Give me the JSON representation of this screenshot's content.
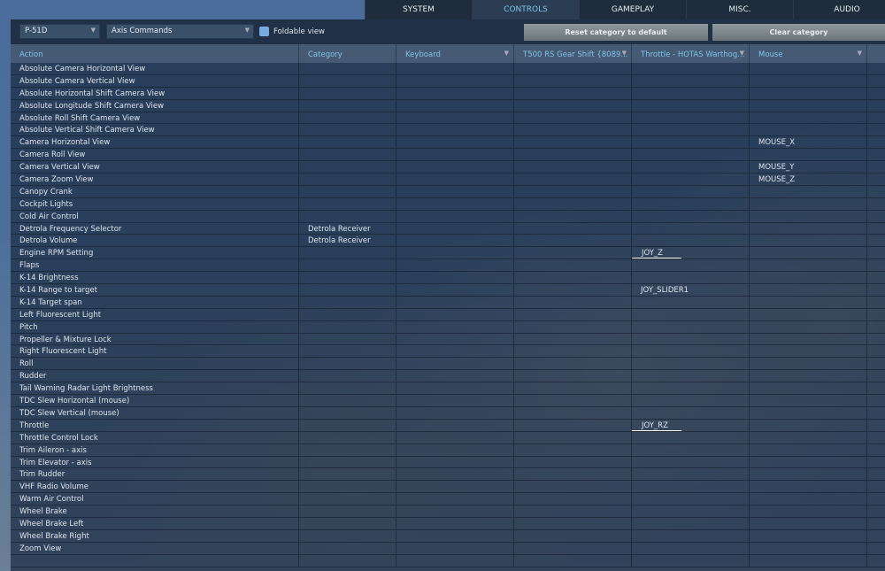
{
  "tabs": [
    "SYSTEM",
    "CONTROLS",
    "GAMEPLAY",
    "MISC.",
    "AUDIO"
  ],
  "active_tab": 1,
  "toolbar": {
    "aircraft": "P-51D",
    "category": "Axis Commands",
    "foldable_label": "Foldable view",
    "reset_label": "Reset category to default",
    "clear_label": "Clear category"
  },
  "columns": [
    "Action",
    "Category",
    "Keyboard",
    "T500 RS Gear Shift {8089...",
    "Throttle - HOTAS Warthog...",
    "Mouse"
  ],
  "rows": [
    [
      "Absolute Camera Horizontal View",
      "",
      "",
      "",
      "",
      ""
    ],
    [
      "Absolute Camera Vertical View",
      "",
      "",
      "",
      "",
      ""
    ],
    [
      "Absolute Horizontal Shift Camera View",
      "",
      "",
      "",
      "",
      ""
    ],
    [
      "Absolute Longitude Shift Camera View",
      "",
      "",
      "",
      "",
      ""
    ],
    [
      "Absolute Roll Shift Camera View",
      "",
      "",
      "",
      "",
      ""
    ],
    [
      "Absolute Vertical Shift Camera View",
      "",
      "",
      "",
      "",
      ""
    ],
    [
      "Camera Horizontal View",
      "",
      "",
      "",
      "",
      "MOUSE_X"
    ],
    [
      "Camera Roll View",
      "",
      "",
      "",
      "",
      ""
    ],
    [
      "Camera Vertical View",
      "",
      "",
      "",
      "",
      "MOUSE_Y"
    ],
    [
      "Camera Zoom View",
      "",
      "",
      "",
      "",
      "MOUSE_Z"
    ],
    [
      "Canopy Crank",
      "",
      "",
      "",
      "",
      ""
    ],
    [
      "Cockpit Lights",
      "",
      "",
      "",
      "",
      ""
    ],
    [
      "Cold Air Control",
      "",
      "",
      "",
      "",
      ""
    ],
    [
      "Detrola Frequency Selector",
      "Detrola Receiver",
      "",
      "",
      "",
      ""
    ],
    [
      "Detrola Volume",
      "Detrola Receiver",
      "",
      "",
      "",
      ""
    ],
    [
      "Engine RPM Setting",
      "",
      "",
      "",
      "JOY_Z",
      ""
    ],
    [
      "Flaps",
      "",
      "",
      "",
      "",
      ""
    ],
    [
      "K-14 Brightness",
      "",
      "",
      "",
      "",
      ""
    ],
    [
      "K-14 Range to target",
      "",
      "",
      "",
      "JOY_SLIDER1",
      ""
    ],
    [
      "K-14 Target span",
      "",
      "",
      "",
      "",
      ""
    ],
    [
      "Left Fluorescent Light",
      "",
      "",
      "",
      "",
      ""
    ],
    [
      "Pitch",
      "",
      "",
      "",
      "",
      ""
    ],
    [
      "Propeller & Mixture Lock",
      "",
      "",
      "",
      "",
      ""
    ],
    [
      "Right Fluorescent Light",
      "",
      "",
      "",
      "",
      ""
    ],
    [
      "Roll",
      "",
      "",
      "",
      "",
      ""
    ],
    [
      "Rudder",
      "",
      "",
      "",
      "",
      ""
    ],
    [
      "Tail Warning Radar Light Brightness",
      "",
      "",
      "",
      "",
      ""
    ],
    [
      "TDC Slew Horizontal (mouse)",
      "",
      "",
      "",
      "",
      ""
    ],
    [
      "TDC Slew Vertical (mouse)",
      "",
      "",
      "",
      "",
      ""
    ],
    [
      "Throttle",
      "",
      "",
      "",
      "JOY_RZ",
      ""
    ],
    [
      "Throttle Control Lock",
      "",
      "",
      "",
      "",
      ""
    ],
    [
      "Trim Aileron - axis",
      "",
      "",
      "",
      "",
      ""
    ],
    [
      "Trim Elevator - axis",
      "",
      "",
      "",
      "",
      ""
    ],
    [
      "Trim Rudder",
      "",
      "",
      "",
      "",
      ""
    ],
    [
      "VHF Radio Volume",
      "",
      "",
      "",
      "",
      ""
    ],
    [
      "Warm Air Control",
      "",
      "",
      "",
      "",
      ""
    ],
    [
      "Wheel Brake",
      "",
      "",
      "",
      "",
      ""
    ],
    [
      "Wheel Brake Left",
      "",
      "",
      "",
      "",
      ""
    ],
    [
      "Wheel Brake Right",
      "",
      "",
      "",
      "",
      ""
    ],
    [
      "Zoom View",
      "",
      "",
      "",
      "",
      ""
    ],
    [
      "",
      "",
      "",
      "",
      "",
      ""
    ]
  ],
  "underlined_cells": [
    "JOY_Z",
    "JOY_RZ"
  ]
}
